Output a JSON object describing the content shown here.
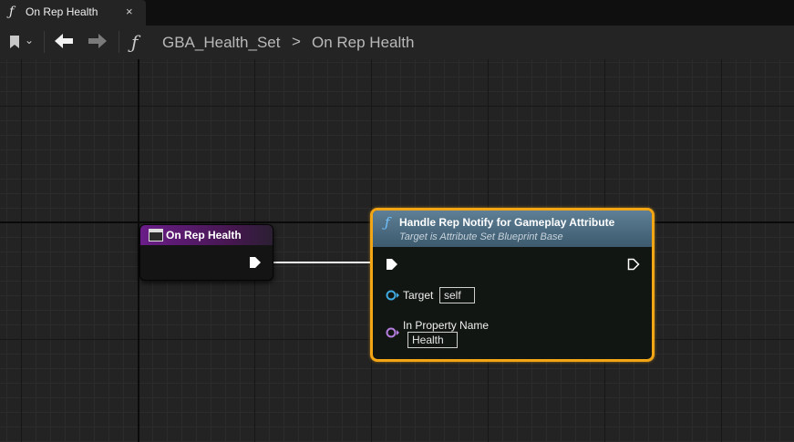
{
  "tab": {
    "icon": "function-icon",
    "title": "On Rep Health",
    "close": "×"
  },
  "toolbar": {
    "bookmark_icon": "bookmark-icon",
    "chevron": "⌄",
    "breadcrumb": {
      "icon": "function-icon",
      "parent": "GBA_Health_Set",
      "separator": ">",
      "current": "On Rep Health"
    }
  },
  "event_node": {
    "title": "On Rep Health",
    "header_color": "#6a1d88"
  },
  "call_node": {
    "title": "Handle Rep Notify for Gameplay Attribute",
    "subtitle": "Target is Attribute Set Blueprint Base",
    "border_color": "#f2a515",
    "pins": {
      "target": {
        "label": "Target",
        "value": "self",
        "color": "#3fa9e0"
      },
      "property": {
        "label": "In Property Name",
        "value": "Health",
        "color": "#b67de0"
      }
    }
  }
}
